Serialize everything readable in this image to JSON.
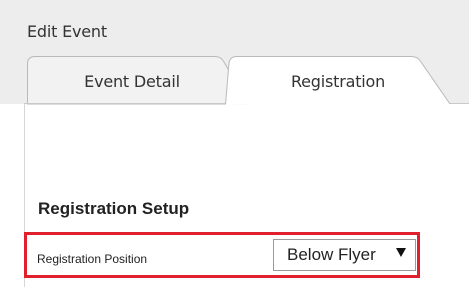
{
  "dialog": {
    "title": "Edit Event"
  },
  "tabs": [
    {
      "label": "Event Detail",
      "active": false
    },
    {
      "label": "Registration",
      "active": true
    }
  ],
  "section": {
    "title": "Registration Setup"
  },
  "fields": {
    "registration_position": {
      "label": "Registration Position",
      "value": "Below Flyer"
    }
  },
  "colors": {
    "highlight": "#e0202c",
    "tab_inactive": "#f2f2f2",
    "tab_active": "#ffffff"
  }
}
